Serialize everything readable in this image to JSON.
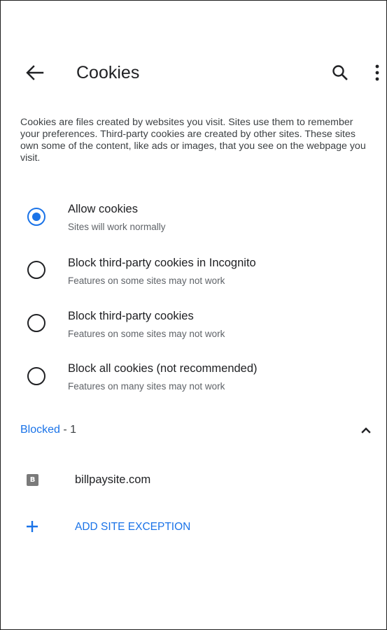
{
  "toolbar": {
    "back_icon": "arrow-back-icon",
    "title": "Cookies",
    "search_icon": "search-icon",
    "more_icon": "more-vert-icon"
  },
  "description": "Cookies are files created by websites you visit. Sites use them to remember your preferences. Third-party cookies are created by other sites. These sites own some of the content, like ads or images, that you see on the webpage you visit.",
  "options": [
    {
      "title": "Allow cookies",
      "subtitle": "Sites will work normally",
      "checked": true
    },
    {
      "title": "Block third-party cookies in Incognito",
      "subtitle": "Features on some sites may not work",
      "checked": false
    },
    {
      "title": "Block third-party cookies",
      "subtitle": "Features on some sites may not work",
      "checked": false
    },
    {
      "title": "Block all cookies (not recommended)",
      "subtitle": "Features on many sites may not work",
      "checked": false
    }
  ],
  "blocked": {
    "label": "Blocked",
    "count": " - 1",
    "expanded": true,
    "chevron_icon": "chevron-up-icon",
    "sites": [
      {
        "favicon_letter": "B",
        "name": "billpaysite.com"
      }
    ]
  },
  "add_exception": {
    "icon": "plus-icon",
    "label": "ADD SITE EXCEPTION"
  },
  "colors": {
    "accent": "#1a73e8",
    "text_primary": "#202124",
    "text_secondary": "#5f6368"
  }
}
